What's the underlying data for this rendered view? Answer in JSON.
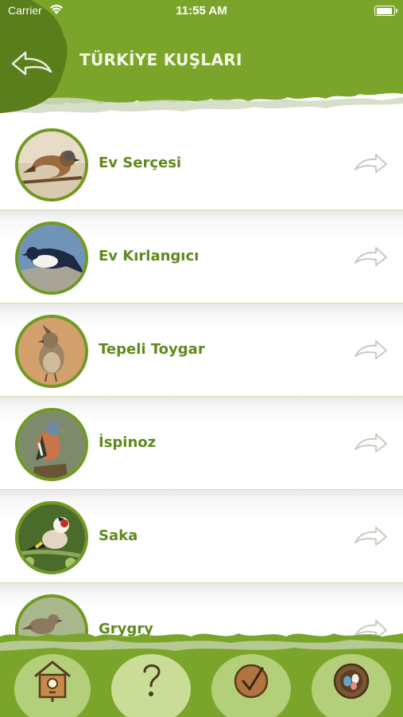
{
  "status_bar": {
    "carrier": "Carrier",
    "time": "11:55 AM"
  },
  "header": {
    "title": "TÜRKİYE KUŞLARI"
  },
  "birds": [
    {
      "name": "Ev Serçesi"
    },
    {
      "name": "Ev Kırlangıcı"
    },
    {
      "name": "Tepeli Toygar"
    },
    {
      "name": "İspinoz"
    },
    {
      "name": "Saka"
    },
    {
      "name": "Grygry"
    }
  ],
  "tab_bar": {
    "icons": [
      "birdhouse-icon",
      "question-icon",
      "checkmark-icon",
      "nest-eggs-icon"
    ]
  },
  "colors": {
    "header_green": "#7ba52a",
    "dark_green": "#5a7e1c",
    "text_green": "#5e8a1c",
    "light_green": "#a8c466"
  }
}
